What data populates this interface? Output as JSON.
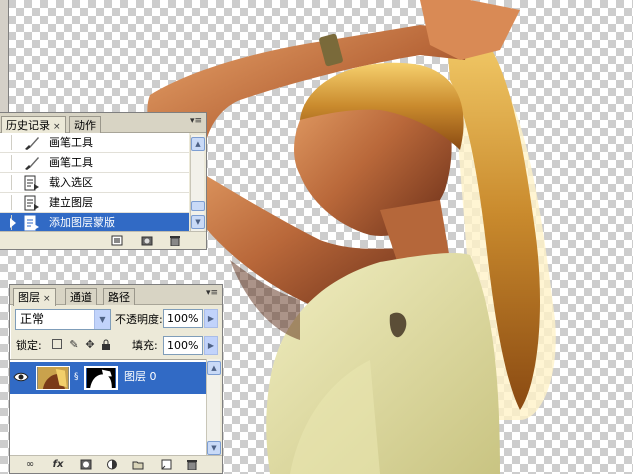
{
  "history_panel": {
    "tabs": [
      {
        "label": "历史记录",
        "close": "×"
      },
      {
        "label": "动作"
      }
    ],
    "menu_glyph": "▾≡",
    "items": [
      {
        "label": "画笔工具",
        "icon": "brush-icon"
      },
      {
        "label": "画笔工具",
        "icon": "brush-icon"
      },
      {
        "label": "载入选区",
        "icon": "history-state-icon"
      },
      {
        "label": "建立图层",
        "icon": "history-state-icon"
      },
      {
        "label": "添加图层蒙版",
        "icon": "history-state-icon",
        "selected": true
      }
    ],
    "footer_icons": [
      "new-document-from-state-icon",
      "new-snapshot-icon",
      "trash-icon"
    ]
  },
  "layers_panel": {
    "tabs": [
      {
        "label": "图层",
        "close": "×"
      },
      {
        "label": "通道"
      },
      {
        "label": "路径"
      }
    ],
    "menu_glyph": "▾≡",
    "blend_mode": "正常",
    "opacity_label": "不透明度:",
    "opacity_value": "100%",
    "lock_label": "锁定:",
    "fill_label": "填充:",
    "fill_value": "100%",
    "layers": [
      {
        "name": "图层 0",
        "selected": true
      }
    ],
    "footer_icons": [
      "link-icon",
      "fx-icon",
      "mask-icon",
      "adjustment-icon",
      "group-folder-icon",
      "new-layer-icon",
      "trash-icon"
    ],
    "fx_label": "fx"
  },
  "colors": {
    "selection": "#316ac5",
    "panel_bg": "#ece9d8"
  }
}
